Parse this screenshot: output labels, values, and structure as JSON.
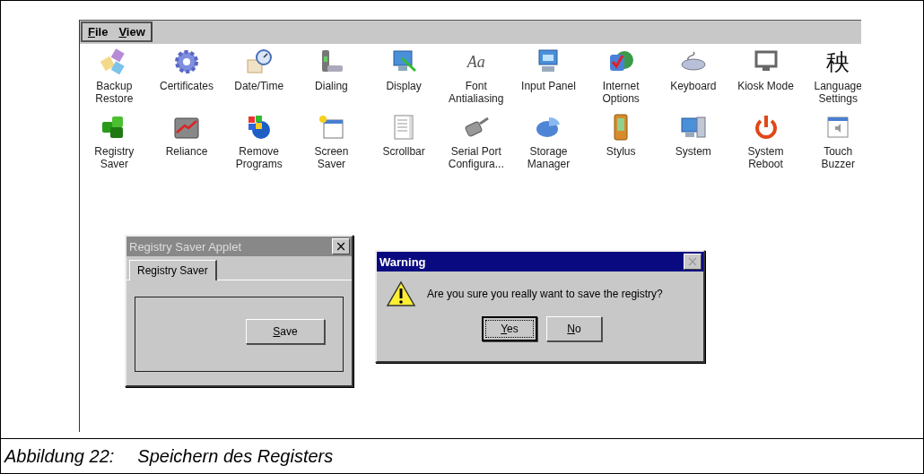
{
  "menu": [
    {
      "label": "File"
    },
    {
      "label": "View"
    }
  ],
  "icons": [
    {
      "lines": [
        "Backup",
        "Restore"
      ]
    },
    {
      "lines": [
        "Certificates"
      ]
    },
    {
      "lines": [
        "Date/Time"
      ]
    },
    {
      "lines": [
        "Dialing"
      ]
    },
    {
      "lines": [
        "Display"
      ]
    },
    {
      "lines": [
        "Font",
        "Antialiasing"
      ],
      "glyph": "Aa"
    },
    {
      "lines": [
        "Input Panel"
      ]
    },
    {
      "lines": [
        "Internet",
        "Options"
      ]
    },
    {
      "lines": [
        "Keyboard"
      ]
    },
    {
      "lines": [
        "Kiosk Mode"
      ]
    },
    {
      "lines": [
        "Language",
        "Settings"
      ],
      "glyph": "秧"
    },
    {
      "lines": [
        "Registry",
        "Saver"
      ]
    },
    {
      "lines": [
        "Reliance"
      ]
    },
    {
      "lines": [
        "Remove",
        "Programs"
      ]
    },
    {
      "lines": [
        "Screen",
        "Saver"
      ]
    },
    {
      "lines": [
        "Scrollbar"
      ]
    },
    {
      "lines": [
        "Serial Port",
        "Configura..."
      ]
    },
    {
      "lines": [
        "Storage",
        "Manager"
      ]
    },
    {
      "lines": [
        "Stylus"
      ]
    },
    {
      "lines": [
        "System"
      ]
    },
    {
      "lines": [
        "System",
        "Reboot"
      ]
    },
    {
      "lines": [
        "Touch",
        "Buzzer"
      ]
    }
  ],
  "applet": {
    "title": "Registry Saver Applet",
    "active": false,
    "close": "×",
    "close_disabled": false,
    "tabs": [
      {
        "label": "Registry Saver",
        "selected": true
      }
    ],
    "button": {
      "label": "Save",
      "focused": false
    }
  },
  "warning": {
    "title": "Warning",
    "active": true,
    "close": "×",
    "close_disabled": true,
    "message": "Are you sure you really want to save the registry?",
    "buttons": [
      {
        "label": "Yes",
        "focused": true
      },
      {
        "label": "No",
        "focused": false
      }
    ]
  },
  "caption": {
    "label": "Abbildung 22:",
    "text": "Speichern des Registers"
  }
}
